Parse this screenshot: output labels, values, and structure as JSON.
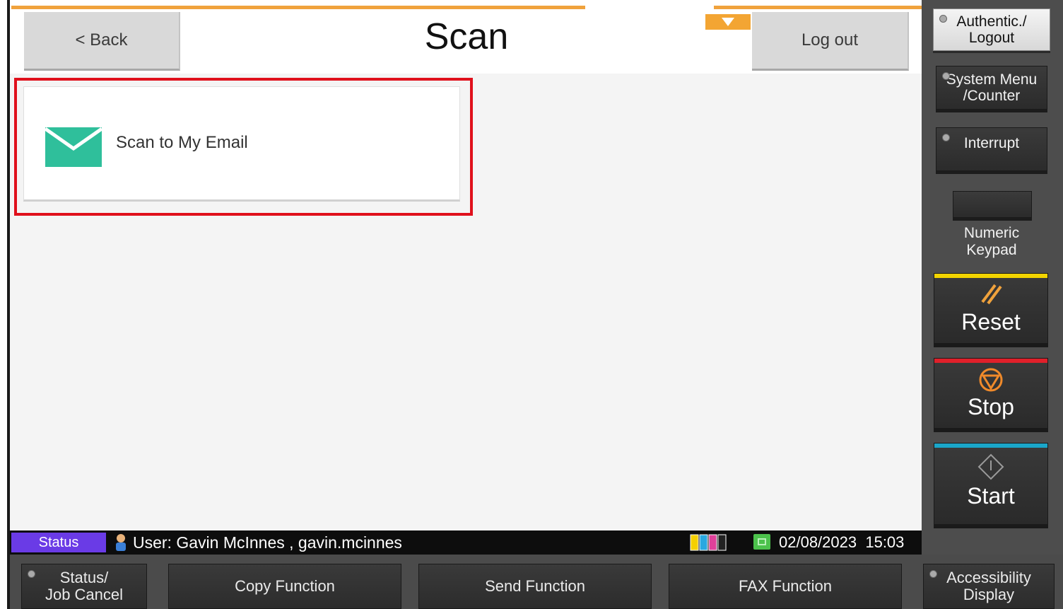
{
  "header": {
    "back_label": "< Back",
    "title": "Scan",
    "logout_label": "Log out"
  },
  "main": {
    "items": [
      {
        "label": "Scan to My Email",
        "icon": "envelope-icon",
        "highlighted": true
      }
    ]
  },
  "statusbar": {
    "status_label": "Status",
    "user_text": "User: Gavin McInnes , gavin.mcinnes",
    "date": "02/08/2023",
    "time": "15:03"
  },
  "side_panel": {
    "authentic_logout": "Authentic./\nLogout",
    "system_menu": "System Menu\n/Counter",
    "interrupt": "Interrupt",
    "numeric_keypad": "Numeric\nKeypad",
    "reset": "Reset",
    "stop": "Stop",
    "start": "Start"
  },
  "bottom_panel": {
    "status_job_cancel": "Status/\nJob Cancel",
    "copy_function": "Copy Function",
    "send_function": "Send Function",
    "fax_function": "FAX Function",
    "accessibility_display": "Accessibility\nDisplay"
  },
  "colors": {
    "accent_orange": "#f0a23c",
    "highlight_red": "#e0101c",
    "envelope_teal": "#2fbf9b",
    "status_purple": "#6a3be6",
    "reset_yellow": "#f2d400",
    "stop_red": "#e0202a",
    "start_teal": "#1aa6c9"
  }
}
